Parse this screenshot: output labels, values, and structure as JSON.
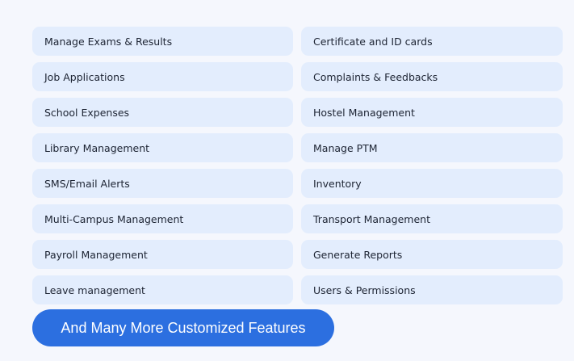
{
  "features": [
    "Manage Exams & Results",
    "Certificate and ID cards",
    "Job Applications",
    "Complaints & Feedbacks",
    "School Expenses",
    "Hostel Management",
    "Library Management",
    "Manage PTM",
    "SMS/Email Alerts",
    "Inventory",
    "Multi-Campus Management",
    "Transport Management",
    "Payroll Management",
    "Generate Reports",
    "Leave management",
    "Users & Permissions"
  ],
  "cta": {
    "label": "And Many More Customized Features"
  },
  "colors": {
    "background": "#f5f7fd",
    "pill": "#e3edfd",
    "pill_text": "#1d2433",
    "cta": "#2c6fe0",
    "cta_text": "#ffffff"
  }
}
